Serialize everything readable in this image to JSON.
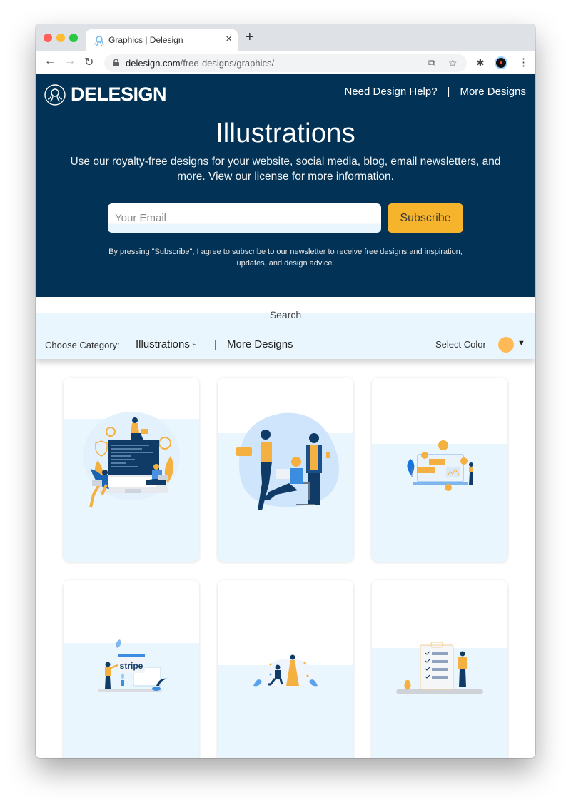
{
  "browser": {
    "tab_title": "Graphics | Delesign",
    "tab_close": "×",
    "new_tab": "+",
    "url_domain": "delesign.com",
    "url_path": "/free-designs/graphics/",
    "icons": {
      "back": "←",
      "forward": "→",
      "reload": "↻",
      "translate": "⧉",
      "star": "☆",
      "extensions": "✱",
      "menu": "⋮"
    }
  },
  "header": {
    "logo_text": "DELESIGN",
    "links": [
      {
        "label": "Need Design Help?"
      },
      {
        "label": "|"
      },
      {
        "label": "More Designs"
      }
    ]
  },
  "hero": {
    "title": "Illustrations",
    "desc_before": "Use our royalty-free designs for your website, social media, blog, email newsletters, and more. View our ",
    "license_link": "license",
    "desc_after": " for more information.",
    "email_placeholder": "Your Email",
    "subscribe_label": "Subscribe",
    "consent": "By pressing \"Subscribe\", I agree to subscribe to our newsletter to receive free designs and inspiration, updates, and design advice."
  },
  "search": {
    "label": "Search"
  },
  "filters": {
    "category_label": "Choose Category:",
    "category_value": "Illustrations",
    "category_chevron": "⌄",
    "separator": "|",
    "more_designs": "More Designs",
    "color_label": "Select Color",
    "color_value": "#ffb957",
    "color_caret": "▼"
  },
  "colors": {
    "navy": "#023255",
    "accent": "#f5b42c",
    "light_blue": "#eaf6fd"
  },
  "cards": [
    {
      "subject": "team-working-on-laptop-code"
    },
    {
      "subject": "team-collaboration-meeting"
    },
    {
      "subject": "crypto-dashboard-presentation"
    },
    {
      "subject": "stripe-payment",
      "text": "stripe"
    },
    {
      "subject": "marriage-proposal"
    },
    {
      "subject": "checklist-clipboard"
    }
  ]
}
